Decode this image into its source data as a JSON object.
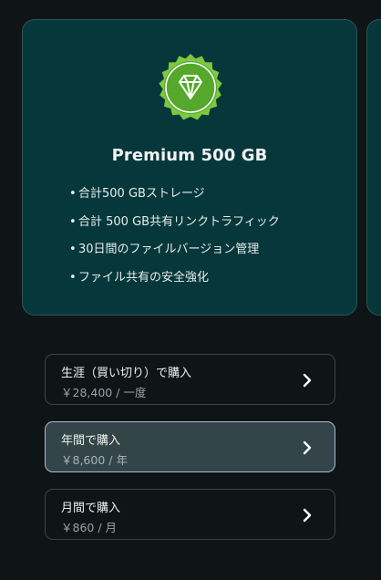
{
  "plan": {
    "title": "Premium 500 GB",
    "badge_icon": "diamond-icon",
    "features": [
      "合計500 GBストレージ",
      "合計 500 GB共有リンクトラフィック",
      "30日間のファイルバージョン管理",
      "ファイル共有の安全強化"
    ]
  },
  "options": [
    {
      "title": "生涯（買い切り）で購入",
      "price": "￥28,400 / 一度",
      "selected": false
    },
    {
      "title": "年間で購入",
      "price": "￥8,600 / 年",
      "selected": true
    },
    {
      "title": "月間で購入",
      "price": "￥860 / 月",
      "selected": false
    }
  ],
  "colors": {
    "background": "#0f1416",
    "card": "#06383b",
    "badge_green": "#6fc23a",
    "selected_option": "#334548"
  }
}
